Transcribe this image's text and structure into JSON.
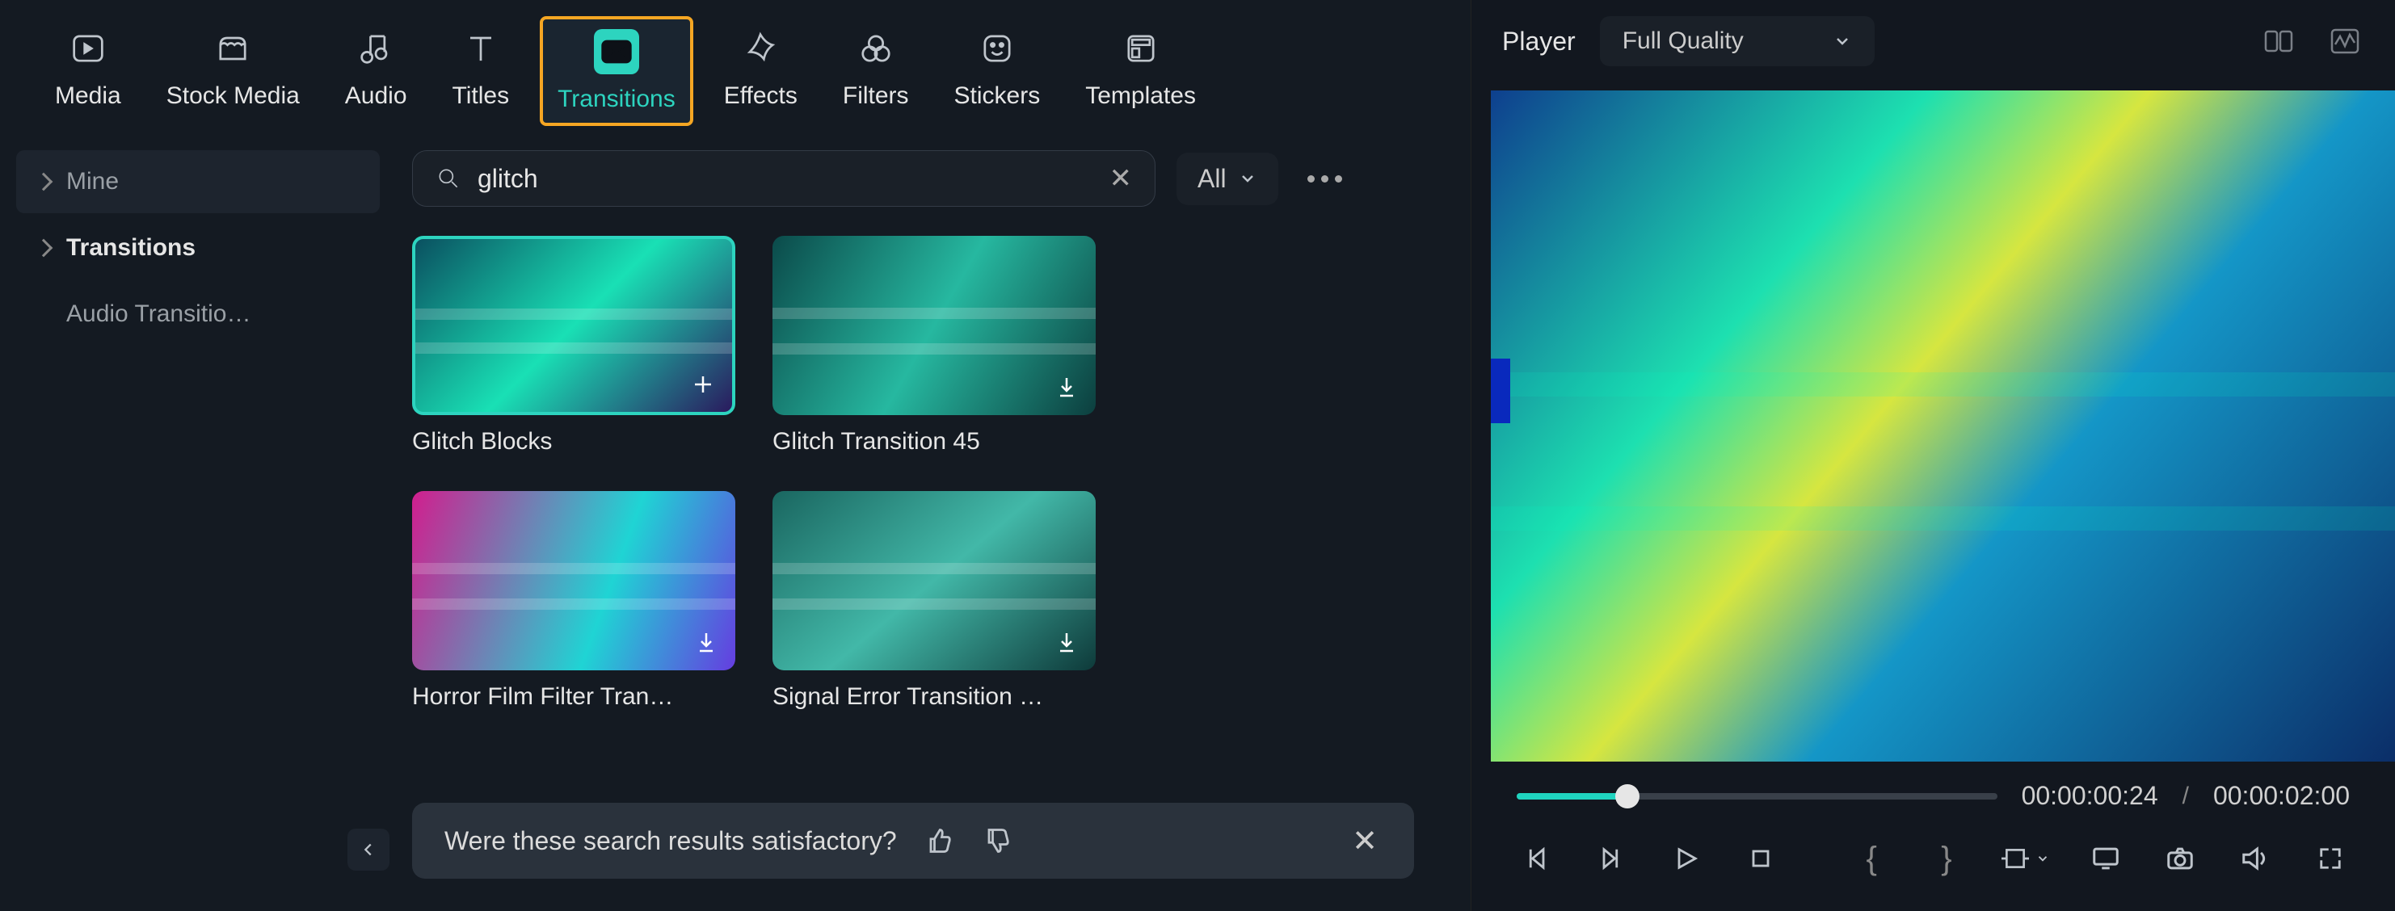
{
  "top_nav": [
    {
      "label": "Media",
      "icon": "media-icon",
      "active": false
    },
    {
      "label": "Stock Media",
      "icon": "stock-media-icon",
      "active": false
    },
    {
      "label": "Audio",
      "icon": "audio-icon",
      "active": false
    },
    {
      "label": "Titles",
      "icon": "titles-icon",
      "active": false
    },
    {
      "label": "Transitions",
      "icon": "transitions-icon",
      "active": true
    },
    {
      "label": "Effects",
      "icon": "effects-icon",
      "active": false
    },
    {
      "label": "Filters",
      "icon": "filters-icon",
      "active": false
    },
    {
      "label": "Stickers",
      "icon": "stickers-icon",
      "active": false
    },
    {
      "label": "Templates",
      "icon": "templates-icon",
      "active": false
    }
  ],
  "sidebar": {
    "items": [
      {
        "label": "Mine",
        "selected": true,
        "bold": false,
        "expandable": true
      },
      {
        "label": "Transitions",
        "selected": false,
        "bold": true,
        "expandable": true
      },
      {
        "label": "Audio Transitio…",
        "selected": false,
        "bold": false,
        "expandable": false
      }
    ]
  },
  "search": {
    "value": "glitch",
    "placeholder": "Search"
  },
  "filter": {
    "label": "All"
  },
  "results": [
    {
      "label": "Glitch Blocks",
      "selected": true,
      "action": "add"
    },
    {
      "label": "Glitch Transition 45",
      "selected": false,
      "action": "download"
    },
    {
      "label": "Horror Film Filter Tran…",
      "selected": false,
      "action": "download"
    },
    {
      "label": "Signal Error Transition …",
      "selected": false,
      "action": "download"
    }
  ],
  "feedback": {
    "question": "Were these search results satisfactory?"
  },
  "player": {
    "title": "Player",
    "quality": "Full Quality",
    "current_time": "00:00:00:24",
    "total_time": "00:00:02:00"
  }
}
